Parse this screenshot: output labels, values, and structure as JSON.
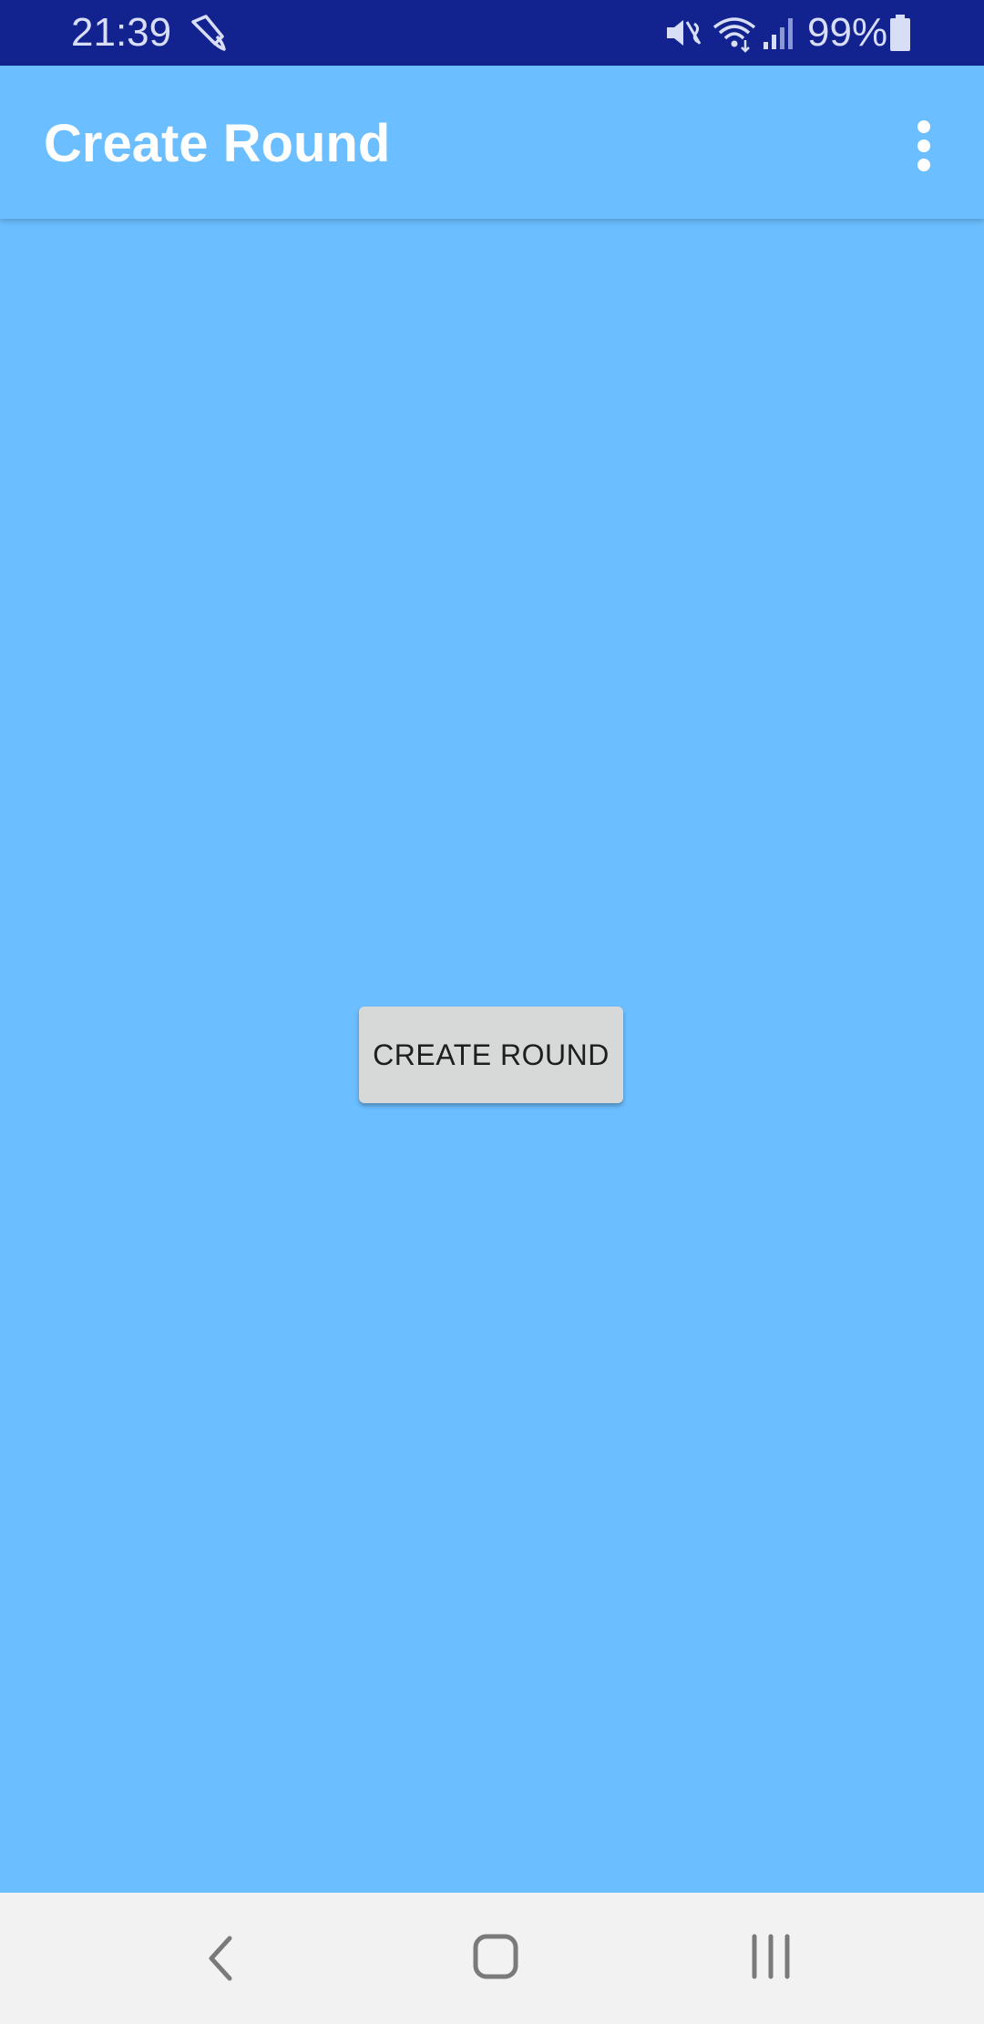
{
  "status_bar": {
    "time": "21:39",
    "battery": "99%",
    "icons": [
      "brush-icon",
      "mute-icon",
      "wifi-icon",
      "signal-icon",
      "battery-icon"
    ]
  },
  "app_bar": {
    "title": "Create Round",
    "menu_icon": "more-vert-icon"
  },
  "main": {
    "create_button_label": "CREATE ROUND"
  },
  "nav_bar": {
    "icons": [
      "back-icon",
      "home-icon",
      "recent-apps-icon"
    ]
  },
  "colors": {
    "status_bar": "#12238f",
    "primary": "#6bbeff",
    "button": "#d7d9d9",
    "nav_bar": "#f2f2f2"
  }
}
